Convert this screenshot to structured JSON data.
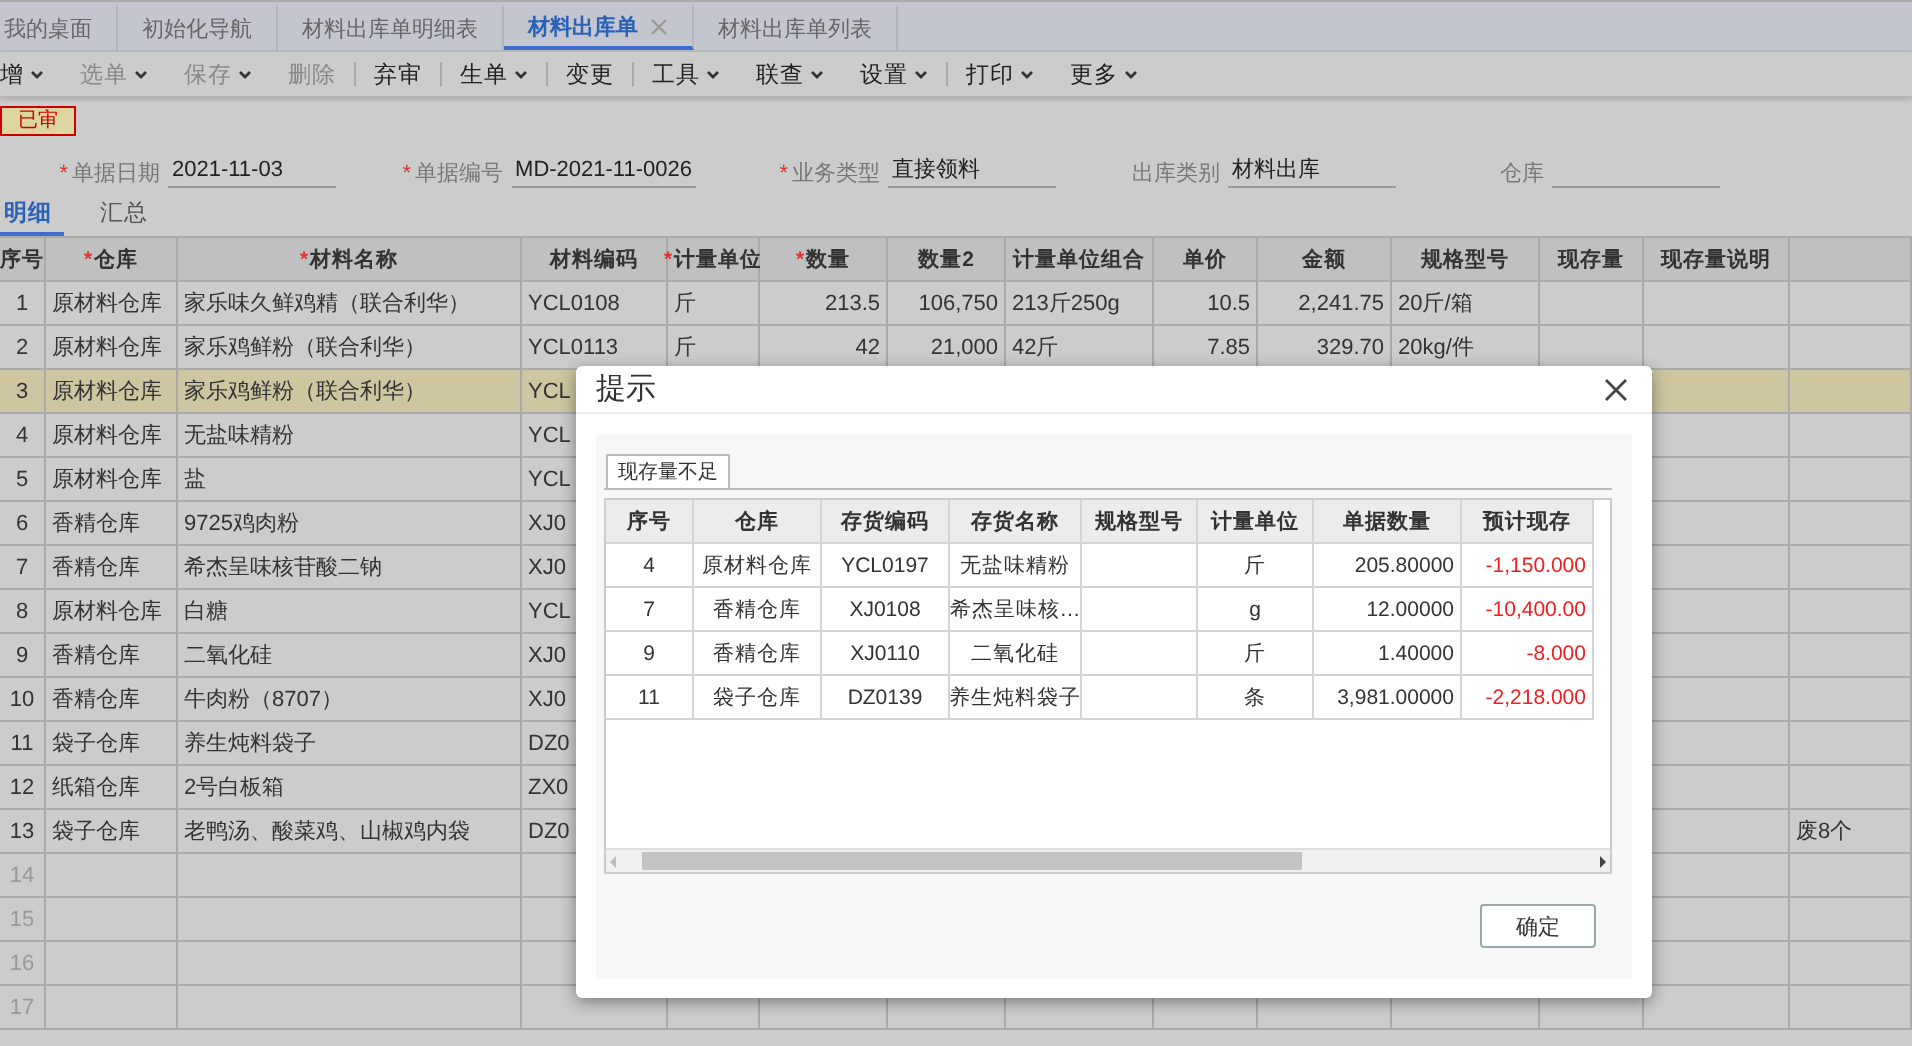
{
  "tabs": [
    {
      "label": "我的桌面",
      "selected": false,
      "closable": false
    },
    {
      "label": "初始化导航",
      "selected": false,
      "closable": false
    },
    {
      "label": "材料出库单明细表",
      "selected": false,
      "closable": false
    },
    {
      "label": "材料出库单",
      "selected": true,
      "closable": true
    },
    {
      "label": "材料出库单列表",
      "selected": false,
      "closable": false
    }
  ],
  "toolbar": [
    {
      "label": "增",
      "dropdown": true,
      "disabled": false,
      "divider_before": false
    },
    {
      "label": "选单",
      "dropdown": true,
      "disabled": true,
      "divider_before": false
    },
    {
      "label": "保存",
      "dropdown": true,
      "disabled": true,
      "divider_before": false
    },
    {
      "label": "删除",
      "dropdown": false,
      "disabled": true,
      "divider_before": false
    },
    {
      "label": "弃审",
      "dropdown": false,
      "disabled": false,
      "divider_before": true
    },
    {
      "label": "生单",
      "dropdown": true,
      "disabled": false,
      "divider_before": true
    },
    {
      "label": "变更",
      "dropdown": false,
      "disabled": false,
      "divider_before": true
    },
    {
      "label": "工具",
      "dropdown": true,
      "disabled": false,
      "divider_before": true
    },
    {
      "label": "联查",
      "dropdown": true,
      "disabled": false,
      "divider_before": false
    },
    {
      "label": "设置",
      "dropdown": true,
      "disabled": false,
      "divider_before": false
    },
    {
      "label": "打印",
      "dropdown": true,
      "disabled": false,
      "divider_before": true
    },
    {
      "label": "更多",
      "dropdown": true,
      "disabled": false,
      "divider_before": false
    }
  ],
  "status_badge": "已审",
  "fields": [
    {
      "label": "单据日期",
      "required_mark": "*",
      "value": "2021-11-03"
    },
    {
      "label": "单据编号",
      "required_mark": "*",
      "value": "MD-2021-11-0026"
    },
    {
      "label": "业务类型",
      "required_mark": "*",
      "value": "直接领料"
    },
    {
      "label": "出库类别",
      "value": "材料出库"
    },
    {
      "label": "仓库"
    }
  ],
  "sub_tabs": [
    {
      "label": "明细",
      "selected": true
    },
    {
      "label": "汇总",
      "selected": false
    }
  ],
  "table": {
    "columns": [
      {
        "label": "序号"
      },
      {
        "label": "仓库",
        "required_mark": "*"
      },
      {
        "label": "材料名称",
        "required_mark": "*"
      },
      {
        "label": "材料编码"
      },
      {
        "label": "计量单位",
        "required_mark": "*"
      },
      {
        "label": "数量",
        "required_mark": "*"
      },
      {
        "label": "数量2"
      },
      {
        "label": "计量单位组合"
      },
      {
        "label": "单价"
      },
      {
        "label": "金额"
      },
      {
        "label": "规格型号"
      },
      {
        "label": "现存量"
      },
      {
        "label": "现存量说明"
      },
      {}
    ],
    "rows": [
      {
        "selected": false,
        "cells": [
          "1",
          "原材料仓库",
          "家乐味久鲜鸡精（联合利华）",
          "YCL0108",
          "斤",
          "213.5",
          "106,750",
          "213斤250g",
          "10.5",
          "2,241.75",
          "20斤/箱",
          null,
          null,
          null
        ]
      },
      {
        "selected": false,
        "cells": [
          "2",
          "原材料仓库",
          "家乐鸡鲜粉（联合利华）",
          "YCL0113",
          "斤",
          "42",
          "21,000",
          "42斤",
          "7.85",
          "329.70",
          "20kg/件",
          null,
          null,
          null
        ]
      },
      {
        "selected": true,
        "cells": [
          "3",
          "原材料仓库",
          "家乐鸡鲜粉（联合利华）",
          "YCL",
          null,
          null,
          null,
          null,
          null,
          null,
          null,
          null,
          null,
          null
        ]
      },
      {
        "selected": false,
        "cells": [
          "4",
          "原材料仓库",
          "无盐味精粉",
          "YCL",
          null,
          null,
          null,
          null,
          null,
          null,
          null,
          null,
          null,
          null
        ]
      },
      {
        "selected": false,
        "cells": [
          "5",
          "原材料仓库",
          "盐",
          "YCL",
          null,
          null,
          null,
          null,
          null,
          null,
          null,
          null,
          null,
          null
        ]
      },
      {
        "selected": false,
        "cells": [
          "6",
          "香精仓库",
          "9725鸡肉粉",
          "XJ0",
          null,
          null,
          null,
          null,
          null,
          null,
          null,
          null,
          null,
          null
        ]
      },
      {
        "selected": false,
        "cells": [
          "7",
          "香精仓库",
          "希杰呈味核苷酸二钠",
          "XJ0",
          null,
          null,
          null,
          null,
          null,
          null,
          null,
          null,
          null,
          null
        ]
      },
      {
        "selected": false,
        "cells": [
          "8",
          "原材料仓库",
          "白糖",
          "YCL",
          null,
          null,
          null,
          null,
          null,
          null,
          null,
          null,
          null,
          null
        ]
      },
      {
        "selected": false,
        "cells": [
          "9",
          "香精仓库",
          "二氧化硅",
          "XJ0",
          null,
          null,
          null,
          null,
          null,
          null,
          null,
          null,
          null,
          null
        ]
      },
      {
        "selected": false,
        "cells": [
          "10",
          "香精仓库",
          "牛肉粉（8707）",
          "XJ0",
          null,
          null,
          null,
          null,
          null,
          null,
          null,
          null,
          null,
          null
        ]
      },
      {
        "selected": false,
        "cells": [
          "11",
          "袋子仓库",
          "养生炖料袋子",
          "DZ0",
          null,
          null,
          null,
          null,
          null,
          null,
          null,
          null,
          null,
          null
        ]
      },
      {
        "selected": false,
        "cells": [
          "12",
          "纸箱仓库",
          "2号白板箱",
          "ZX0",
          null,
          null,
          null,
          null,
          null,
          null,
          null,
          null,
          null,
          null
        ]
      },
      {
        "selected": false,
        "cells": [
          "13",
          "袋子仓库",
          "老鸭汤、酸菜鸡、山椒鸡内袋",
          "DZ0",
          null,
          null,
          null,
          null,
          null,
          null,
          null,
          null,
          null,
          "废8个"
        ]
      },
      {
        "selected": false,
        "cells": [
          "14",
          null,
          null,
          null,
          null,
          null,
          null,
          null,
          null,
          null,
          null,
          null,
          null,
          null
        ]
      },
      {
        "selected": false,
        "cells": [
          "15",
          null,
          null,
          null,
          null,
          null,
          null,
          null,
          null,
          null,
          null,
          null,
          null,
          null
        ]
      },
      {
        "selected": false,
        "cells": [
          "16",
          null,
          null,
          null,
          null,
          null,
          null,
          null,
          null,
          null,
          null,
          null,
          null,
          null
        ]
      },
      {
        "selected": false,
        "cells": [
          "17",
          null,
          null,
          null,
          null,
          null,
          null,
          null,
          null,
          null,
          null,
          null,
          null,
          null
        ]
      }
    ]
  },
  "dialog": {
    "title": "提示",
    "tab": "现存量不足",
    "columns": [
      "序号",
      "仓库",
      "存货编码",
      "存货名称",
      "规格型号",
      "计量单位",
      "单据数量",
      "预计现存"
    ],
    "rows": [
      [
        "4",
        "原材料仓库",
        "YCL0197",
        "无盐味精粉",
        null,
        "斤",
        "205.80000",
        "-1,150.000"
      ],
      [
        "7",
        "香精仓库",
        "XJ0108",
        "希杰呈味核…",
        null,
        "g",
        "12.00000",
        "-10,400.00"
      ],
      [
        "9",
        "香精仓库",
        "XJ0110",
        "二氧化硅",
        null,
        "斤",
        "1.40000",
        "-8.000"
      ],
      [
        "11",
        "袋子仓库",
        "DZ0139",
        "养生炖料袋子",
        null,
        "条",
        "3,981.00000",
        "-2,218.000"
      ]
    ],
    "ok_button": "确定"
  }
}
